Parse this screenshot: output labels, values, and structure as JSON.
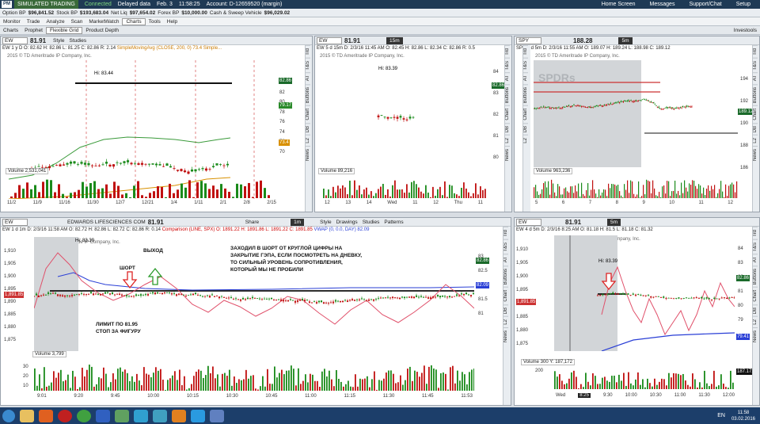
{
  "titlebar": {
    "pm": "PM",
    "mode": "SIMULATED TRADING",
    "connection": "Connected",
    "delayed": "Delayed data",
    "date": "Feb. 3",
    "time": "11:58:25",
    "account": "Account: D-12659520 (margin)",
    "links": [
      "Home Screen",
      "Messages",
      "Support/Chat",
      "Setup"
    ]
  },
  "account": {
    "option_bp_label": "Option BP",
    "option_bp": "$96,841.52",
    "stock_bp_label": "Stock BP",
    "stock_bp": "$193,683.04",
    "net_liq_label": "Net Liq",
    "net_liq": "$97,654.02",
    "forex_bp_label": "Forex BP",
    "forex_bp": "$10,000.00",
    "cash_label": "Cash & Sweep Vehicle",
    "cash": "$96,029.02"
  },
  "mainnav": [
    "Monitor",
    "Trade",
    "Analyze",
    "Scan",
    "MarketWatch",
    "Charts",
    "Tools",
    "Help"
  ],
  "subnav": [
    "Charts",
    "Prophet",
    "Flexible Grid",
    "Product Depth"
  ],
  "investools": "Investools",
  "panels": {
    "p1": {
      "symbol": "EW",
      "price": "81.91",
      "change": "+6.00\n+6.50%",
      "style": "Style",
      "studies": "Studies",
      "hud": "EW 1 y D  O: 82.62  H: 82.86  L: 81.25  C: 82.86  R: 2.14",
      "sma": "SimpleMovingAvg (CLOSE, 200, 0)  73.4  Simple...",
      "copyright": "2015 © TD Ameritrade IP Company, Inc.",
      "hi": "Hi: 83.44",
      "right_axis": [
        "84",
        "82",
        "80",
        "78",
        "76",
        "74",
        "72",
        "70"
      ],
      "last_tag": "82.86",
      "tag2": "79.17",
      "tag3": "73.4",
      "volume": "Volume  2,531,041",
      "vol_axis": [
        "6",
        "4",
        "2"
      ],
      "vol_unit": "-million...",
      "xaxis": [
        "11/2",
        "11/9",
        "11/16",
        "11/30",
        "12/7",
        "12/21",
        "1/4",
        "1/11",
        "2/1",
        "2/8",
        "2/15"
      ]
    },
    "p2": {
      "symbol": "EW",
      "price": "81.91",
      "change": "+6.00\n+6.50%",
      "tf": "15m",
      "hud": "EW 5 d 15m  D: 2/3/16 11:45 AM  O: 82.45  H: 82.86  L: 82.34  C: 82.86  R: 0.5",
      "copyright": "2015 © TD Ameritrade IP Company, Inc.",
      "hi": "Hi: 83.39",
      "right_axis": [
        "84",
        "83",
        "82",
        "81",
        "80"
      ],
      "last_tag": "82.86",
      "volume": "Volume  89,216",
      "vol_axis": [
        "250"
      ],
      "vol_unit": "-thous...",
      "xaxis": [
        "12",
        "13",
        "14",
        "Wed",
        "11",
        "12",
        "Thu",
        "11"
      ]
    },
    "p3": {
      "symbol": "SPY",
      "price": "188.28",
      "change": "",
      "tf": "5m",
      "hud": "SPY 5 d 5m  D: 2/3/16 11:55 AM  O: 189.07  H: 189.24  L: 188.98  C: 189.12",
      "copyright": "2015 © TD Ameritrade IP Company, Inc.",
      "watermark": "SPDRs",
      "right_axis": [
        "194",
        "192",
        "190",
        "188",
        "186"
      ],
      "last_tag": "189.12",
      "volume": "Volume  963,236",
      "vol_axis": [
        "5",
        "2.5"
      ],
      "vol_unit": "-million...",
      "xaxis": [
        "5",
        "6",
        "7",
        "8",
        "9",
        "10",
        "11",
        "12"
      ]
    },
    "p4": {
      "symbol": "EW",
      "title": "EDWARDS LIFESCIENCES COM",
      "price": "81.91",
      "change": "+6.00\n+6.50%",
      "share": "Share",
      "tf": "1m",
      "style": "Style",
      "drawings": "Drawings",
      "studies": "Studies",
      "patterns": "Patterns",
      "hud": "EW 1 d 1m  D: 2/3/16 11:58 AM  O: 82.72  H: 82.86  L: 82.72  C: 82.86  R: 0.14",
      "cmp": "Comparison (LINE, SPX)  O: 1891.22  H: 1891.86  L: 1891.22  C: 1891.85",
      "vwap": "VWAP (0, 0.0, DAY)  82.09",
      "copyright": "2015 © TD Ameritrade IP Company, Inc.",
      "hi": "Hi: 83.39",
      "left_axis": [
        "1,910",
        "1,905",
        "1,900",
        "1,895",
        "1,890",
        "1,885",
        "1,880",
        "1,875"
      ],
      "left_tag": "1,891.85",
      "right_axis": [
        "83",
        "82.5",
        "82",
        "81.5",
        "81"
      ],
      "last_tag": "82.86",
      "tag2": "82.09",
      "annot_short": "ШОРТ",
      "annot_exit": "ВЫХОД",
      "annot_main": [
        "ЗАХОДИЛ В ШОРТ ОТ КРУГЛОЙ ЦИФРЫ НА",
        "ЗАКРЫТИЕ ГЭПА, ЕСЛИ ПОСМОТРЕТЬ НА ДНЕВКУ,",
        "ТО СИЛЬНЫЙ УРОВЕНЬ СОПРОТИВЛЕНИЯ,",
        "КОТОРЫЙ МЫ НЕ ПРОБИЛИ"
      ],
      "annot_limit": [
        "ЛИМИТ ПО 81.95",
        "СТОП ЗА ФИГУРУ"
      ],
      "volume": "Volume  3,799",
      "vol_axis": [
        "30",
        "20",
        "10"
      ],
      "vol_unit": "-thousands-",
      "xaxis": [
        "9:01",
        "9:20",
        "9:45",
        "10:00",
        "10:15",
        "10:30",
        "10:45",
        "11:00",
        "11:15",
        "11:30",
        "11:45",
        "11:53"
      ]
    },
    "p5": {
      "symbol": "EW",
      "price": "81.91",
      "change": "+6.00\n+6.50%",
      "tf": "5m",
      "hud": "EW 4 d 5m  D: 2/3/16 8:25 AM  O: 81.18  H: 81.5  L: 81.18  C: 81.32",
      "copyright": "2015 © TD Ameritrade IP Company, Inc.",
      "hi": "Hi: 83.39",
      "left_axis": [
        "1,910",
        "1,905",
        "1,900",
        "1,895",
        "1,890",
        "1,885",
        "1,880",
        "1,875"
      ],
      "left_tag": "1,891.85",
      "right_axis": [
        "84",
        "83",
        "82",
        "81",
        "80",
        "79"
      ],
      "last_tag": "82.86",
      "tag2": "79.41",
      "volume": "Volume  300  Y: 187,172",
      "vol_axis": [
        "200"
      ],
      "vol_tag": "187.172",
      "vol_unit": "-thousa...",
      "xaxis": [
        "Wed",
        "8:25",
        "9:30",
        "10:00",
        "10:30",
        "11:00",
        "11:30",
        "12:00"
      ]
    }
  },
  "side_tabs": [
    "Trd",
    "T&S",
    "AT",
    "Buttons",
    "Chart",
    "DB",
    "L2",
    "News"
  ],
  "taskbar": {
    "lang": "EN",
    "clock_time": "11:58",
    "clock_date": "03.02.2016"
  }
}
